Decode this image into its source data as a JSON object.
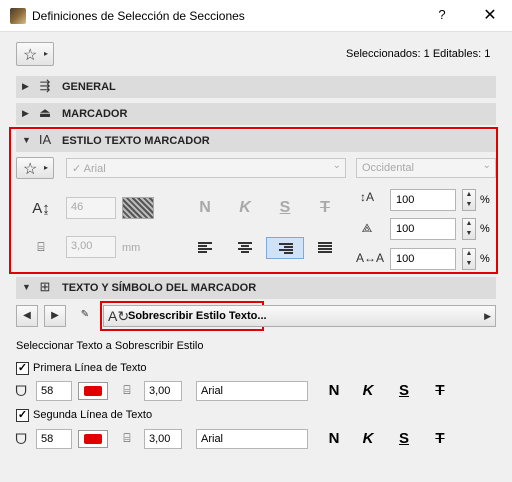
{
  "window": {
    "title": "Definiciones de Selección de Secciones",
    "help": "?",
    "close": "✕"
  },
  "toolbar": {
    "star": "☆",
    "caret": "▸",
    "selection_status": "Seleccionados: 1 Editables: 1"
  },
  "sections": {
    "general": "GENERAL",
    "marker": "MARCADOR",
    "marker_text_style": "ESTILO TEXTO MARCADOR",
    "marker_text_symbol": "TEXTO Y SÍMBOLO DEL MARCADOR"
  },
  "text_style": {
    "font": "✓ Arial",
    "script": "Occidental",
    "text_height": "46",
    "width_value": "3,00",
    "unit": "mm",
    "styles": [
      "N",
      "K",
      "S",
      "T"
    ],
    "width_factor": "100",
    "spacing_factor": "100",
    "baseline_factor": "100",
    "pct": "%"
  },
  "override": {
    "label": "Sobrescribir Estilo Texto...",
    "section_label": "Seleccionar Texto a Sobrescribir Estilo"
  },
  "lines": [
    {
      "label": "Primera Línea de Texto",
      "checked": "✓",
      "height": "58",
      "width": "3,00",
      "font": "Arial",
      "styles": [
        "N",
        "K",
        "S",
        "T"
      ]
    },
    {
      "label": "Segunda Línea de Texto",
      "checked": "✓",
      "height": "58",
      "width": "3,00",
      "font": "Arial",
      "styles": [
        "N",
        "K",
        "S",
        "T"
      ]
    }
  ],
  "colors": {
    "highlight": "#e00000",
    "active_align": "#cfe2f7",
    "pen": "#e00000"
  }
}
